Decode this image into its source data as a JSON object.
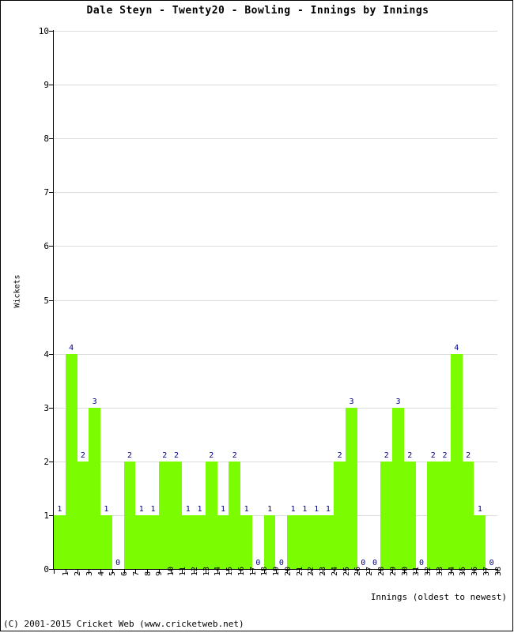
{
  "chart_data": {
    "type": "bar",
    "title": "Dale Steyn - Twenty20 - Bowling - Innings by Innings",
    "xlabel": "Innings (oldest to newest)",
    "ylabel": "Wickets",
    "ylim": [
      0,
      10
    ],
    "ytick_step": 1,
    "yticks": [
      "0",
      "1",
      "2",
      "3",
      "4",
      "5",
      "6",
      "7",
      "8",
      "9",
      "10"
    ],
    "grid": true,
    "legend": "none",
    "bar_color": "#7CFC00",
    "label_color": "#00008B",
    "grid_color": "#DCDCDC",
    "axis_color": "#000000",
    "categories": [
      "1",
      "2",
      "3",
      "4",
      "5",
      "6",
      "7",
      "8",
      "9",
      "10",
      "11",
      "12",
      "13",
      "14",
      "15",
      "16",
      "17",
      "18",
      "19",
      "20",
      "21",
      "22",
      "23",
      "24",
      "25",
      "26",
      "27",
      "28",
      "29",
      "30",
      "31",
      "32",
      "33",
      "34",
      "35",
      "36",
      "37",
      "38"
    ],
    "values": [
      1,
      4,
      2,
      3,
      1,
      0,
      2,
      1,
      1,
      2,
      2,
      1,
      1,
      2,
      1,
      2,
      1,
      0,
      1,
      0,
      1,
      1,
      1,
      1,
      2,
      3,
      0,
      0,
      2,
      3,
      2,
      0,
      2,
      2,
      4,
      2,
      1,
      0
    ],
    "data_labels": [
      "1",
      "4",
      "2",
      "3",
      "1",
      "0",
      "2",
      "1",
      "1",
      "2",
      "2",
      "1",
      "1",
      "2",
      "1",
      "2",
      "1",
      "0",
      "1",
      "0",
      "1",
      "1",
      "1",
      "1",
      "2",
      "3",
      "0",
      "0",
      "2",
      "3",
      "2",
      "0",
      "2",
      "2",
      "4",
      "2",
      "1",
      "0"
    ]
  },
  "footer": {
    "copyright": "(C) 2001-2015 Cricket Web (www.cricketweb.net)"
  }
}
